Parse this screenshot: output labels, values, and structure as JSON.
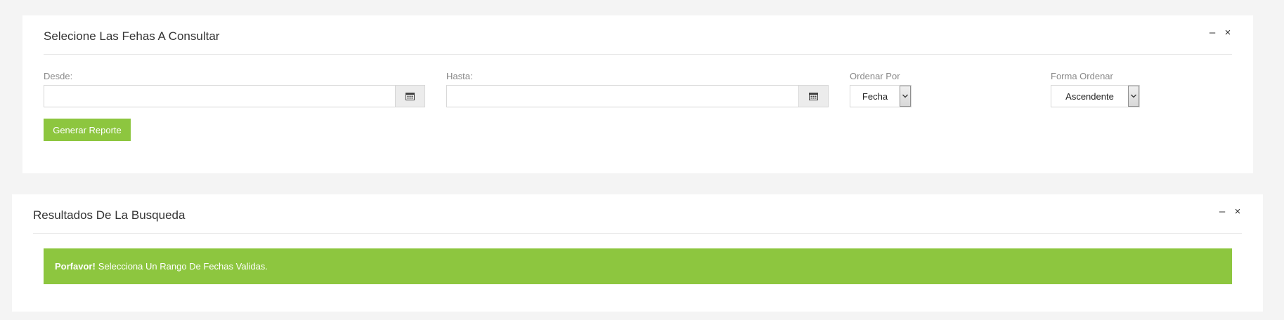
{
  "filters_panel": {
    "title": "Selecione Las Fehas A Consultar",
    "minimize_label": "–",
    "close_label": "×",
    "from": {
      "label": "Desde:",
      "value": "",
      "icon": "calendar-icon"
    },
    "to": {
      "label": "Hasta:",
      "value": "",
      "icon": "calendar-icon"
    },
    "order_by": {
      "label": "Ordenar Por",
      "selected": "Fecha"
    },
    "order_direction": {
      "label": "Forma Ordenar",
      "selected": "Ascendente"
    },
    "generate_button": "Generar Reporte"
  },
  "results_panel": {
    "title": "Resultados De La Busqueda",
    "minimize_label": "–",
    "close_label": "×",
    "alert": {
      "strong": "Porfavor!",
      "message": "Selecciona Un Rango De Fechas Validas."
    }
  },
  "colors": {
    "accent_green": "#8dc63f",
    "page_background": "#f4f4f4"
  }
}
